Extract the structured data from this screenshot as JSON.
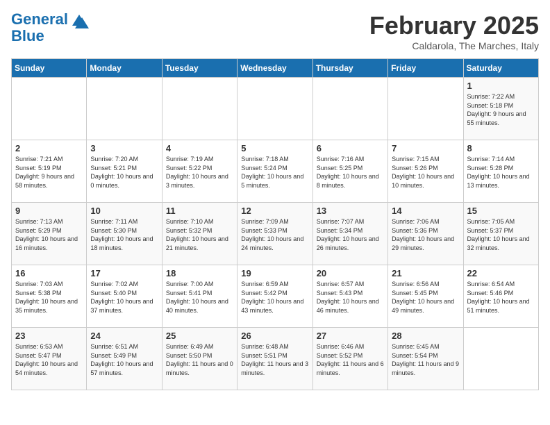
{
  "header": {
    "logo_line1": "General",
    "logo_line2": "Blue",
    "month": "February 2025",
    "location": "Caldarola, The Marches, Italy"
  },
  "days_of_week": [
    "Sunday",
    "Monday",
    "Tuesday",
    "Wednesday",
    "Thursday",
    "Friday",
    "Saturday"
  ],
  "weeks": [
    [
      {
        "day": "",
        "info": ""
      },
      {
        "day": "",
        "info": ""
      },
      {
        "day": "",
        "info": ""
      },
      {
        "day": "",
        "info": ""
      },
      {
        "day": "",
        "info": ""
      },
      {
        "day": "",
        "info": ""
      },
      {
        "day": "1",
        "info": "Sunrise: 7:22 AM\nSunset: 5:18 PM\nDaylight: 9 hours and 55 minutes."
      }
    ],
    [
      {
        "day": "2",
        "info": "Sunrise: 7:21 AM\nSunset: 5:19 PM\nDaylight: 9 hours and 58 minutes."
      },
      {
        "day": "3",
        "info": "Sunrise: 7:20 AM\nSunset: 5:21 PM\nDaylight: 10 hours and 0 minutes."
      },
      {
        "day": "4",
        "info": "Sunrise: 7:19 AM\nSunset: 5:22 PM\nDaylight: 10 hours and 3 minutes."
      },
      {
        "day": "5",
        "info": "Sunrise: 7:18 AM\nSunset: 5:24 PM\nDaylight: 10 hours and 5 minutes."
      },
      {
        "day": "6",
        "info": "Sunrise: 7:16 AM\nSunset: 5:25 PM\nDaylight: 10 hours and 8 minutes."
      },
      {
        "day": "7",
        "info": "Sunrise: 7:15 AM\nSunset: 5:26 PM\nDaylight: 10 hours and 10 minutes."
      },
      {
        "day": "8",
        "info": "Sunrise: 7:14 AM\nSunset: 5:28 PM\nDaylight: 10 hours and 13 minutes."
      }
    ],
    [
      {
        "day": "9",
        "info": "Sunrise: 7:13 AM\nSunset: 5:29 PM\nDaylight: 10 hours and 16 minutes."
      },
      {
        "day": "10",
        "info": "Sunrise: 7:11 AM\nSunset: 5:30 PM\nDaylight: 10 hours and 18 minutes."
      },
      {
        "day": "11",
        "info": "Sunrise: 7:10 AM\nSunset: 5:32 PM\nDaylight: 10 hours and 21 minutes."
      },
      {
        "day": "12",
        "info": "Sunrise: 7:09 AM\nSunset: 5:33 PM\nDaylight: 10 hours and 24 minutes."
      },
      {
        "day": "13",
        "info": "Sunrise: 7:07 AM\nSunset: 5:34 PM\nDaylight: 10 hours and 26 minutes."
      },
      {
        "day": "14",
        "info": "Sunrise: 7:06 AM\nSunset: 5:36 PM\nDaylight: 10 hours and 29 minutes."
      },
      {
        "day": "15",
        "info": "Sunrise: 7:05 AM\nSunset: 5:37 PM\nDaylight: 10 hours and 32 minutes."
      }
    ],
    [
      {
        "day": "16",
        "info": "Sunrise: 7:03 AM\nSunset: 5:38 PM\nDaylight: 10 hours and 35 minutes."
      },
      {
        "day": "17",
        "info": "Sunrise: 7:02 AM\nSunset: 5:40 PM\nDaylight: 10 hours and 37 minutes."
      },
      {
        "day": "18",
        "info": "Sunrise: 7:00 AM\nSunset: 5:41 PM\nDaylight: 10 hours and 40 minutes."
      },
      {
        "day": "19",
        "info": "Sunrise: 6:59 AM\nSunset: 5:42 PM\nDaylight: 10 hours and 43 minutes."
      },
      {
        "day": "20",
        "info": "Sunrise: 6:57 AM\nSunset: 5:43 PM\nDaylight: 10 hours and 46 minutes."
      },
      {
        "day": "21",
        "info": "Sunrise: 6:56 AM\nSunset: 5:45 PM\nDaylight: 10 hours and 49 minutes."
      },
      {
        "day": "22",
        "info": "Sunrise: 6:54 AM\nSunset: 5:46 PM\nDaylight: 10 hours and 51 minutes."
      }
    ],
    [
      {
        "day": "23",
        "info": "Sunrise: 6:53 AM\nSunset: 5:47 PM\nDaylight: 10 hours and 54 minutes."
      },
      {
        "day": "24",
        "info": "Sunrise: 6:51 AM\nSunset: 5:49 PM\nDaylight: 10 hours and 57 minutes."
      },
      {
        "day": "25",
        "info": "Sunrise: 6:49 AM\nSunset: 5:50 PM\nDaylight: 11 hours and 0 minutes."
      },
      {
        "day": "26",
        "info": "Sunrise: 6:48 AM\nSunset: 5:51 PM\nDaylight: 11 hours and 3 minutes."
      },
      {
        "day": "27",
        "info": "Sunrise: 6:46 AM\nSunset: 5:52 PM\nDaylight: 11 hours and 6 minutes."
      },
      {
        "day": "28",
        "info": "Sunrise: 6:45 AM\nSunset: 5:54 PM\nDaylight: 11 hours and 9 minutes."
      },
      {
        "day": "",
        "info": ""
      }
    ]
  ]
}
